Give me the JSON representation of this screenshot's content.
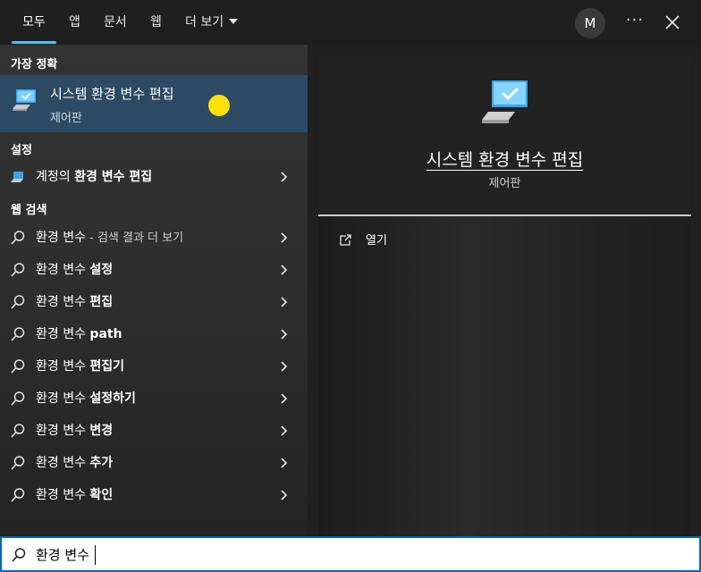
{
  "tabs": [
    {
      "label": "모두"
    },
    {
      "label": "앱"
    },
    {
      "label": "문서"
    },
    {
      "label": "웹"
    },
    {
      "label": "더 보기"
    }
  ],
  "account": {
    "initial": "M"
  },
  "more_icon": "ellipsis-icon",
  "sections": {
    "best_match": "가장 정확",
    "settings": "설정",
    "web_search": "웹 검색"
  },
  "best_match": {
    "title": "시스템 환경 변수 편집",
    "subtitle": "제어판"
  },
  "settings_items": [
    {
      "prefix": "계정의 ",
      "bold": "환경 변수 편집"
    }
  ],
  "web_items": [
    {
      "prefix": "환경 변수",
      "bold": "",
      "muted": " - 검색 결과 더 보기"
    },
    {
      "prefix": "환경 변수 ",
      "bold": "설정",
      "muted": ""
    },
    {
      "prefix": "환경 변수 ",
      "bold": "편집",
      "muted": ""
    },
    {
      "prefix": "환경 변수 ",
      "bold": "path",
      "muted": ""
    },
    {
      "prefix": "환경 변수 ",
      "bold": "편집기",
      "muted": ""
    },
    {
      "prefix": "환경 변수 ",
      "bold": "설정하기",
      "muted": ""
    },
    {
      "prefix": "환경 변수 ",
      "bold": "변경",
      "muted": ""
    },
    {
      "prefix": "환경 변수 ",
      "bold": "추가",
      "muted": ""
    },
    {
      "prefix": "환경 변수 ",
      "bold": "확인",
      "muted": ""
    }
  ],
  "preview": {
    "title": "시스템 환경 변수 편집",
    "subtitle": "제어판",
    "open_label": "열기"
  },
  "search": {
    "value": "환경 변수"
  },
  "colors": {
    "accent": "#4cc2ff",
    "selected_row": "#2c4a63",
    "search_border": "#0067c0"
  }
}
